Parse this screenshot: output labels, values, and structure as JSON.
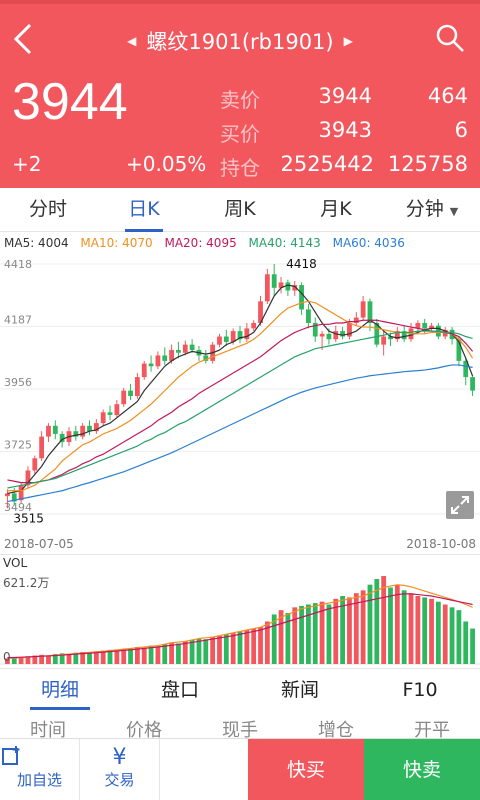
{
  "header": {
    "title": "螺纹1901(rb1901)",
    "price": "3944",
    "change": "+2",
    "change_pct": "+0.05%",
    "sell_label": "卖价",
    "sell_price": "3944",
    "sell_qty": "464",
    "buy_label": "买价",
    "buy_price": "3943",
    "buy_qty": "6",
    "oi_label": "持仓",
    "oi_value": "2525442",
    "oi_change": "125758"
  },
  "tabs": [
    {
      "label": "分时"
    },
    {
      "label": "日K"
    },
    {
      "label": "周K"
    },
    {
      "label": "月K"
    },
    {
      "label": "分钟"
    }
  ],
  "ma": {
    "ma5": "MA5: 4004",
    "ma10": "MA10: 4070",
    "ma20": "MA20: 4095",
    "ma40": "MA40: 4143",
    "ma60": "MA60: 4036"
  },
  "colors": {
    "up": "#f2575e",
    "down": "#2eb75e",
    "ma5": "#333333",
    "ma10": "#f0901f",
    "ma20": "#c2185b",
    "ma40": "#26a269",
    "ma60": "#2a7fd4",
    "accent": "#2e62c7"
  },
  "chart_data": {
    "type": "candlestick",
    "y_ticks": [
      "4418",
      "4187",
      "3956",
      "3725",
      "3494"
    ],
    "ylim": [
      3494,
      4418
    ],
    "date_start": "2018-07-05",
    "date_end": "2018-10-08",
    "high_label": "4418",
    "low_label": "3515",
    "candles": [
      [
        3560,
        3570,
        3515,
        3585
      ],
      [
        3570,
        3540,
        3525,
        3590
      ],
      [
        3545,
        3600,
        3535,
        3610
      ],
      [
        3600,
        3655,
        3590,
        3670
      ],
      [
        3655,
        3700,
        3640,
        3710
      ],
      [
        3700,
        3780,
        3690,
        3800
      ],
      [
        3780,
        3820,
        3760,
        3830
      ],
      [
        3820,
        3790,
        3770,
        3840
      ],
      [
        3790,
        3760,
        3740,
        3800
      ],
      [
        3760,
        3800,
        3745,
        3815
      ],
      [
        3800,
        3780,
        3765,
        3820
      ],
      [
        3780,
        3820,
        3770,
        3830
      ],
      [
        3820,
        3800,
        3785,
        3840
      ],
      [
        3800,
        3830,
        3790,
        3845
      ],
      [
        3830,
        3870,
        3820,
        3880
      ],
      [
        3870,
        3860,
        3840,
        3895
      ],
      [
        3860,
        3900,
        3850,
        3915
      ],
      [
        3900,
        3950,
        3890,
        3960
      ],
      [
        3950,
        3930,
        3915,
        3975
      ],
      [
        3930,
        4000,
        3920,
        4015
      ],
      [
        4000,
        4050,
        3990,
        4060
      ],
      [
        4050,
        4040,
        4020,
        4080
      ],
      [
        4040,
        4080,
        4030,
        4095
      ],
      [
        4080,
        4060,
        4045,
        4110
      ],
      [
        4060,
        4100,
        4050,
        4120
      ],
      [
        4100,
        4090,
        4070,
        4130
      ],
      [
        4090,
        4120,
        4080,
        4135
      ],
      [
        4120,
        4100,
        4090,
        4140
      ],
      [
        4100,
        4080,
        4060,
        4115
      ],
      [
        4080,
        4060,
        4050,
        4100
      ],
      [
        4060,
        4120,
        4050,
        4130
      ],
      [
        4120,
        4150,
        4110,
        4160
      ],
      [
        4150,
        4130,
        4115,
        4175
      ],
      [
        4130,
        4170,
        4120,
        4180
      ],
      [
        4170,
        4140,
        4125,
        4190
      ],
      [
        4140,
        4180,
        4130,
        4200
      ],
      [
        4180,
        4200,
        4170,
        4210
      ],
      [
        4200,
        4280,
        4190,
        4300
      ],
      [
        4280,
        4380,
        4270,
        4400
      ],
      [
        4380,
        4330,
        4300,
        4418
      ],
      [
        4330,
        4350,
        4310,
        4370
      ],
      [
        4350,
        4320,
        4300,
        4360
      ],
      [
        4320,
        4340,
        4300,
        4355
      ],
      [
        4340,
        4250,
        4230,
        4350
      ],
      [
        4250,
        4200,
        4180,
        4270
      ],
      [
        4200,
        4150,
        4130,
        4220
      ],
      [
        4150,
        4160,
        4100,
        4170
      ],
      [
        4160,
        4140,
        4120,
        4180
      ],
      [
        4140,
        4170,
        4130,
        4190
      ],
      [
        4170,
        4150,
        4140,
        4185
      ],
      [
        4150,
        4200,
        4140,
        4215
      ],
      [
        4200,
        4220,
        4190,
        4240
      ],
      [
        4220,
        4280,
        4210,
        4300
      ],
      [
        4280,
        4200,
        4170,
        4290
      ],
      [
        4200,
        4120,
        4110,
        4215
      ],
      [
        4120,
        4150,
        4080,
        4170
      ],
      [
        4150,
        4140,
        4115,
        4165
      ],
      [
        4140,
        4170,
        4130,
        4185
      ],
      [
        4170,
        4140,
        4130,
        4190
      ],
      [
        4140,
        4180,
        4130,
        4200
      ],
      [
        4180,
        4200,
        4170,
        4210
      ],
      [
        4200,
        4180,
        4160,
        4215
      ],
      [
        4180,
        4190,
        4170,
        4200
      ],
      [
        4190,
        4150,
        4140,
        4200
      ],
      [
        4150,
        4175,
        4140,
        4185
      ],
      [
        4175,
        4140,
        4120,
        4185
      ],
      [
        4140,
        4060,
        4040,
        4150
      ],
      [
        4060,
        4000,
        3970,
        4070
      ],
      [
        4000,
        3950,
        3930,
        4005
      ]
    ],
    "ma_lines": {
      "ma5": [
        3570,
        3575,
        3580,
        3610,
        3640,
        3670,
        3710,
        3740,
        3770,
        3780,
        3785,
        3790,
        3800,
        3805,
        3820,
        3830,
        3850,
        3870,
        3890,
        3910,
        3950,
        3980,
        4010,
        4040,
        4060,
        4075,
        4085,
        4095,
        4090,
        4085,
        4090,
        4100,
        4120,
        4130,
        4145,
        4150,
        4165,
        4200,
        4250,
        4300,
        4330,
        4340,
        4335,
        4310,
        4280,
        4240,
        4200,
        4170,
        4160,
        4155,
        4160,
        4170,
        4190,
        4210,
        4195,
        4170,
        4150,
        4145,
        4150,
        4155,
        4165,
        4175,
        4180,
        4180,
        4170,
        4160,
        4130,
        4070,
        4004
      ],
      "ma10": [
        3580,
        3580,
        3580,
        3590,
        3600,
        3620,
        3640,
        3660,
        3690,
        3710,
        3730,
        3750,
        3760,
        3775,
        3790,
        3800,
        3810,
        3825,
        3840,
        3860,
        3880,
        3900,
        3925,
        3950,
        3975,
        4000,
        4020,
        4040,
        4055,
        4065,
        4075,
        4085,
        4095,
        4105,
        4115,
        4125,
        4140,
        4160,
        4185,
        4210,
        4235,
        4255,
        4265,
        4275,
        4280,
        4275,
        4260,
        4245,
        4230,
        4215,
        4200,
        4190,
        4185,
        4185,
        4180,
        4175,
        4170,
        4165,
        4165,
        4160,
        4160,
        4160,
        4165,
        4165,
        4165,
        4160,
        4140,
        4110,
        4070
      ],
      "ma20": [
        3620,
        3615,
        3610,
        3610,
        3610,
        3615,
        3620,
        3630,
        3640,
        3655,
        3665,
        3680,
        3690,
        3705,
        3715,
        3730,
        3745,
        3760,
        3775,
        3790,
        3805,
        3820,
        3840,
        3855,
        3870,
        3890,
        3905,
        3920,
        3940,
        3955,
        3970,
        3985,
        4000,
        4015,
        4030,
        4045,
        4060,
        4075,
        4095,
        4115,
        4135,
        4150,
        4165,
        4175,
        4185,
        4190,
        4195,
        4195,
        4200,
        4200,
        4205,
        4205,
        4210,
        4210,
        4210,
        4205,
        4200,
        4195,
        4190,
        4185,
        4180,
        4175,
        4170,
        4170,
        4165,
        4160,
        4150,
        4125,
        4095
      ],
      "ma40": [
        3590,
        3595,
        3600,
        3605,
        3610,
        3615,
        3620,
        3625,
        3635,
        3645,
        3655,
        3665,
        3675,
        3685,
        3695,
        3705,
        3715,
        3725,
        3735,
        3745,
        3760,
        3770,
        3785,
        3795,
        3810,
        3825,
        3835,
        3850,
        3865,
        3880,
        3895,
        3910,
        3925,
        3940,
        3955,
        3970,
        3985,
        4000,
        4015,
        4030,
        4045,
        4060,
        4075,
        4085,
        4095,
        4105,
        4110,
        4115,
        4120,
        4125,
        4130,
        4135,
        4140,
        4145,
        4150,
        4155,
        4160,
        4165,
        4165,
        4165,
        4170,
        4170,
        4170,
        4170,
        4165,
        4165,
        4160,
        4150,
        4143
      ],
      "ma60": [
        3540,
        3545,
        3550,
        3555,
        3560,
        3565,
        3570,
        3575,
        3580,
        3588,
        3595,
        3603,
        3610,
        3618,
        3626,
        3634,
        3642,
        3650,
        3660,
        3670,
        3680,
        3690,
        3700,
        3710,
        3720,
        3732,
        3744,
        3756,
        3768,
        3780,
        3792,
        3804,
        3816,
        3828,
        3840,
        3852,
        3864,
        3876,
        3888,
        3900,
        3912,
        3924,
        3934,
        3944,
        3952,
        3960,
        3966,
        3972,
        3978,
        3984,
        3990,
        3996,
        4000,
        4005,
        4008,
        4011,
        4014,
        4017,
        4020,
        4022,
        4024,
        4026,
        4030,
        4034,
        4040,
        4045,
        4045,
        4040,
        4036
      ]
    },
    "volume": {
      "label": "VOL",
      "max_label": "621.2万",
      "zero_label": "0",
      "max": 621.2,
      "values": [
        40,
        45,
        50,
        55,
        60,
        65,
        60,
        70,
        75,
        70,
        80,
        85,
        80,
        90,
        95,
        100,
        95,
        105,
        110,
        120,
        115,
        130,
        125,
        140,
        150,
        145,
        160,
        170,
        180,
        175,
        190,
        200,
        210,
        220,
        230,
        240,
        250,
        260,
        300,
        350,
        380,
        360,
        400,
        410,
        420,
        430,
        440,
        420,
        460,
        480,
        470,
        500,
        520,
        560,
        600,
        621,
        540,
        560,
        520,
        500,
        480,
        470,
        460,
        440,
        420,
        400,
        380,
        300,
        250
      ],
      "ma_a": [
        40,
        42,
        45,
        48,
        52,
        55,
        58,
        62,
        66,
        70,
        74,
        78,
        82,
        86,
        90,
        95,
        100,
        105,
        110,
        115,
        120,
        125,
        130,
        140,
        150,
        155,
        160,
        170,
        180,
        185,
        190,
        200,
        210,
        220,
        230,
        240,
        250,
        260,
        280,
        300,
        330,
        350,
        370,
        390,
        400,
        410,
        420,
        430,
        440,
        450,
        460,
        470,
        480,
        500,
        520,
        540,
        550,
        560,
        555,
        545,
        530,
        515,
        500,
        485,
        470,
        455,
        440,
        420,
        400
      ],
      "ma_b": [
        45,
        46,
        48,
        50,
        52,
        55,
        57,
        60,
        63,
        66,
        70,
        73,
        76,
        80,
        84,
        88,
        92,
        96,
        100,
        105,
        110,
        115,
        120,
        126,
        132,
        138,
        145,
        152,
        160,
        168,
        176,
        184,
        192,
        200,
        210,
        220,
        230,
        240,
        255,
        270,
        285,
        300,
        315,
        330,
        345,
        360,
        375,
        390,
        400,
        410,
        420,
        430,
        440,
        450,
        460,
        470,
        480,
        490,
        495,
        495,
        490,
        485,
        480,
        470,
        460,
        450,
        440,
        430,
        420
      ]
    }
  },
  "subtabs": [
    {
      "label": "明细"
    },
    {
      "label": "盘口"
    },
    {
      "label": "新闻"
    },
    {
      "label": "F10"
    }
  ],
  "columns": [
    "时间",
    "价格",
    "现手",
    "增仓",
    "开平"
  ],
  "bottom": {
    "watch_label": "加自选",
    "trade_label": "交易",
    "buy_label": "快买",
    "sell_label": "快卖"
  }
}
